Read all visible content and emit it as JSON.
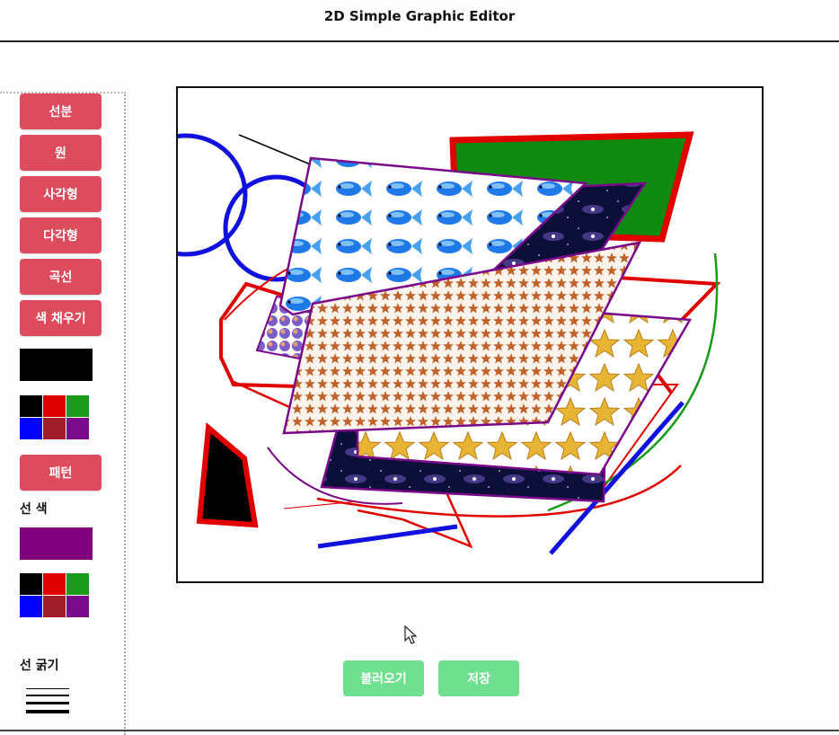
{
  "app": {
    "title": "2D Simple Graphic Editor"
  },
  "toolbar": {
    "tools": [
      {
        "label": "선분"
      },
      {
        "label": "원"
      },
      {
        "label": "사각형"
      },
      {
        "label": "다각형"
      },
      {
        "label": "곡선"
      },
      {
        "label": "색 채우기"
      }
    ],
    "fill_color_current": "#000000",
    "palette": [
      "#000000",
      "#e00000",
      "#1a9a1a",
      "#0000ff",
      "#a01e2a",
      "#7a0a8a"
    ],
    "pattern_label": "패턴",
    "line_color_label": "선 색",
    "line_color_current": "#800080",
    "line_width_label": "선 굵기",
    "line_widths": [
      1,
      2,
      3,
      4
    ]
  },
  "actions": {
    "load_label": "불러오기",
    "save_label": "저장"
  },
  "icons": {
    "cursor": "mouse-pointer-icon"
  }
}
